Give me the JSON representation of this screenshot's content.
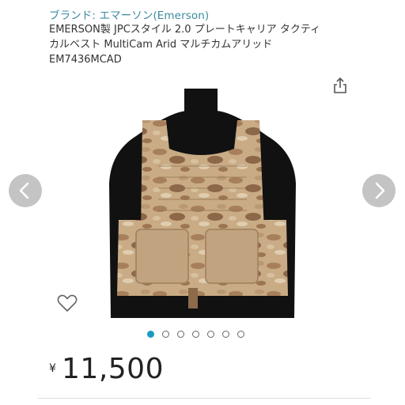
{
  "product": {
    "brand": "ブランド: エマーソン(Emerson)",
    "title_lines": [
      "EMERSON製 JPCスタイル 2.0 プレートキャリア タクティ",
      "カルベスト MultiCam Arid マルチカムアリッド",
      "EM7436MCAD"
    ],
    "currency": "¥",
    "price": "11,500"
  },
  "gallery": {
    "dot_count": 7,
    "active_index": 0
  },
  "icons": {
    "share": "share-icon",
    "prev": "chevron-left-icon",
    "next": "chevron-right-icon",
    "favorite": "heart-icon"
  },
  "colors": {
    "brand_link": "#3a8aa0",
    "active_dot": "#1a9abf",
    "nav_button": "#c4c4c4"
  }
}
